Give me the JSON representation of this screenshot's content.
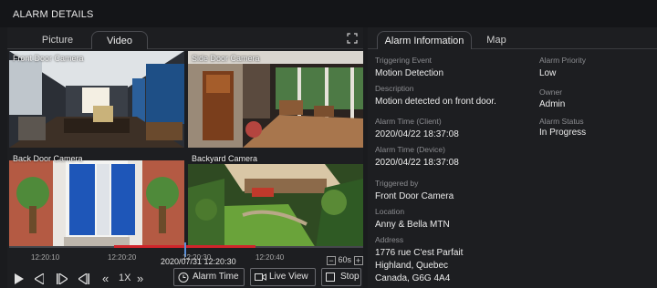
{
  "window": {
    "title": "ALARM DETAILS"
  },
  "left_tabs": [
    {
      "label": "Picture"
    },
    {
      "label": "Video"
    }
  ],
  "cameras": [
    {
      "label": "Front Door Camera"
    },
    {
      "label": "Side Door Camera"
    },
    {
      "label": "Back Door Camera"
    },
    {
      "label": "Backyard Camera"
    }
  ],
  "timeline": {
    "ticks": [
      "12:20:10",
      "12:20:20",
      "12:20:30",
      "12:20:40"
    ],
    "current": "2020/07/31 12:20:30",
    "zoom": "60s",
    "zoom_minus": "−",
    "zoom_plus": "+"
  },
  "controls": {
    "speed": "1X",
    "alarm_time": "Alarm Time",
    "live_view": "Live View",
    "stop": "Stop"
  },
  "right_tabs": [
    {
      "label": "Alarm Information"
    },
    {
      "label": "Map"
    }
  ],
  "info": {
    "triggering_event_label": "Triggering Event",
    "triggering_event": "Motion Detection",
    "description_label": "Description",
    "description": "Motion detected on front door.",
    "alarm_time_client_label": "Alarm Time (Client)",
    "alarm_time_client": "2020/04/22 18:37:08",
    "alarm_time_device_label": "Alarm Time (Device)",
    "alarm_time_device": "2020/04/22 18:37:08",
    "triggered_by_label": "Triggered by",
    "triggered_by": "Front Door Camera",
    "location_label": "Location",
    "location": "Anny & Bella MTN",
    "address_label": "Address",
    "address_line1": "1776 rue C'est Parfait",
    "address_line2": "Highland, Quebec",
    "address_line3": "Canada, G6G 4A4",
    "alarm_priority_label": "Alarm Priority",
    "alarm_priority": "Low",
    "owner_label": "Owner",
    "owner": "Admin",
    "alarm_status_label": "Alarm Status",
    "alarm_status": "In Progress"
  },
  "colors": {
    "accent_red": "#d0242b",
    "cursor_blue": "#5b8fd6"
  }
}
